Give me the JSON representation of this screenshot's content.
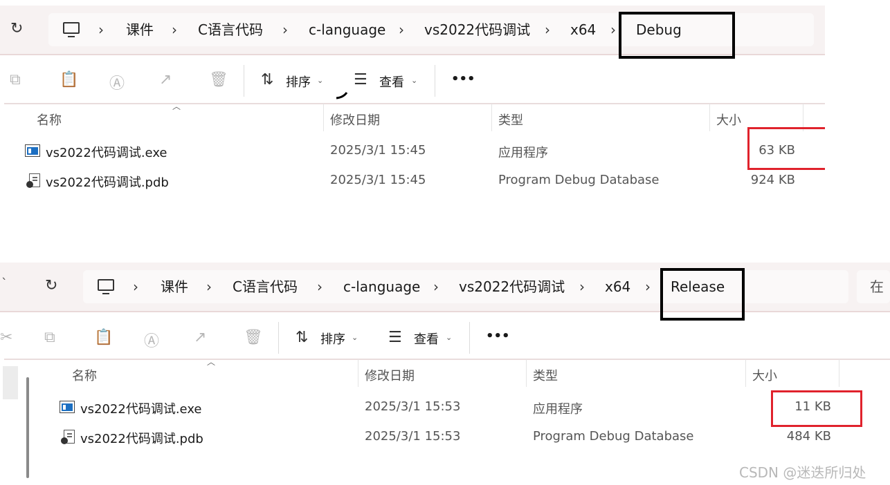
{
  "debug_window": {
    "breadcrumb": [
      "课件",
      "C语言代码",
      "c-language",
      "vs2022代码调试",
      "x64",
      "Debug"
    ],
    "toolbar": {
      "sort_label": "排序",
      "view_label": "查看",
      "more_label": "•••"
    },
    "columns": {
      "name": "名称",
      "date": "修改日期",
      "type": "类型",
      "size": "大小"
    },
    "files": [
      {
        "name": "vs2022代码调试.exe",
        "date": "2025/3/1 15:45",
        "type": "应用程序",
        "size": "63 KB",
        "icon": "exe-icon"
      },
      {
        "name": "vs2022代码调试.pdb",
        "date": "2025/3/1 15:45",
        "type": "Program Debug Database",
        "size": "924 KB",
        "icon": "pdb-icon"
      }
    ]
  },
  "release_window": {
    "breadcrumb": [
      "课件",
      "C语言代码",
      "c-language",
      "vs2022代码调试",
      "x64",
      "Release"
    ],
    "search_placeholder_fragment": "在",
    "toolbar": {
      "sort_label": "排序",
      "view_label": "查看",
      "more_label": "•••"
    },
    "columns": {
      "name": "名称",
      "date": "修改日期",
      "type": "类型",
      "size": "大小"
    },
    "files": [
      {
        "name": "vs2022代码调试.exe",
        "date": "2025/3/1 15:53",
        "type": "应用程序",
        "size": "11 KB",
        "icon": "exe-icon"
      },
      {
        "name": "vs2022代码调试.pdb",
        "date": "2025/3/1 15:53",
        "type": "Program Debug Database",
        "size": "484 KB",
        "icon": "pdb-icon"
      }
    ]
  },
  "annotation_colors": {
    "folder_highlight": "#000000",
    "size_highlight": "#e0222c"
  },
  "watermark": "CSDN @迷迭所归处"
}
